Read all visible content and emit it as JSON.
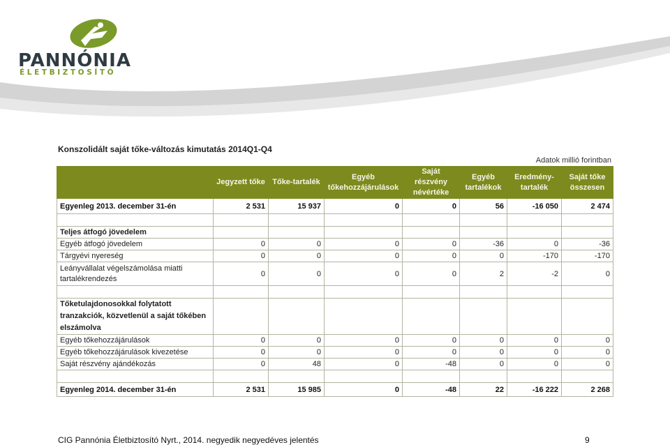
{
  "logo": {
    "name": "PANNÓNIA",
    "tagline": "ÉLETBIZTOSÍTÓ"
  },
  "title": "Konszolidált saját tőke-változás kimutatás 2014Q1-Q4",
  "unit_note": "Adatok millió forintban",
  "colors": {
    "header_bg": "#7c8a1e",
    "accent_green": "#7a9a2a",
    "swoosh_grey": "#d2d2d2"
  },
  "table": {
    "headers": [
      "",
      "Jegyzett tőke",
      "Tőke-tartalék",
      "Egyéb tőkehozzájárulások",
      "Saját részvény névértéke",
      "Egyéb tartalékok",
      "Eredmény-tartalék",
      "Saját tőke összesen"
    ],
    "header_lines": [
      [
        "",
        ""
      ],
      [
        "Jegyzett tőke",
        ""
      ],
      [
        "Tőke-tartalék",
        ""
      ],
      [
        "Egyéb",
        "tőkehozzájárulások"
      ],
      [
        "Saját részvény",
        "névértéke"
      ],
      [
        "Egyéb",
        "tartalékok"
      ],
      [
        "Eredmény-",
        "tartalék"
      ],
      [
        "Saját tőke",
        "összesen"
      ]
    ],
    "opening": {
      "label": "Egyenleg  2013. december 31-én",
      "values": [
        "2 531",
        "15 937",
        "0",
        "0",
        "56",
        "-16 050",
        "2 474"
      ]
    },
    "tci_section": "Teljes átfogó jövedelem",
    "tci_rows": [
      {
        "label": "Egyéb átfogó jövedelem",
        "values": [
          "0",
          "0",
          "0",
          "0",
          "-36",
          "0",
          "-36"
        ]
      },
      {
        "label": "Tárgyévi nyereség",
        "values": [
          "0",
          "0",
          "0",
          "0",
          "0",
          "-170",
          "-170"
        ]
      },
      {
        "label": "Leányvállalat végelszámolása miatti tartalékrendezés",
        "values": [
          "0",
          "0",
          "0",
          "0",
          "2",
          "-2",
          "0"
        ]
      }
    ],
    "owner_section": "Tőketulajdonosokkal folytatott tranzakciók, közvetlenül a saját tőkében elszámolva",
    "owner_rows": [
      {
        "label": "Egyéb tőkehozzájárulások",
        "values": [
          "0",
          "0",
          "0",
          "0",
          "0",
          "0",
          "0"
        ]
      },
      {
        "label": "Egyéb tőkehozzájárulások kivezetése",
        "values": [
          "0",
          "0",
          "0",
          "0",
          "0",
          "0",
          "0"
        ]
      },
      {
        "label": "Saját részvény ajándékozás",
        "values": [
          "0",
          "48",
          "0",
          "-48",
          "0",
          "0",
          "0"
        ]
      }
    ],
    "closing": {
      "label": "Egyenleg  2014. december 31-én",
      "values": [
        "2 531",
        "15 985",
        "0",
        "-48",
        "22",
        "-16 222",
        "2 268"
      ]
    }
  },
  "footer": {
    "text": "CIG Pannónia Életbiztosító Nyrt., 2014. negyedik negyedéves jelentés",
    "page": "9"
  }
}
